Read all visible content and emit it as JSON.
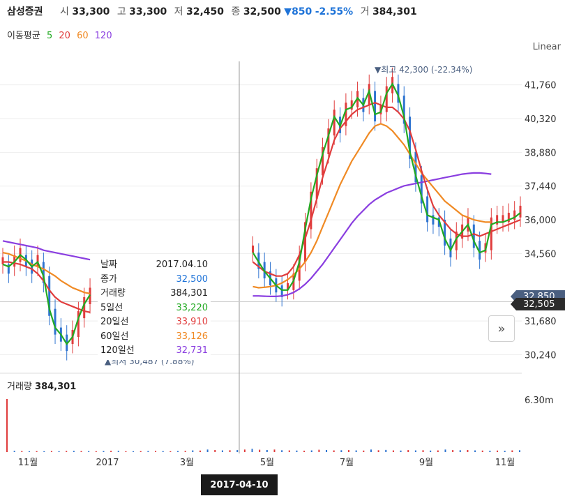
{
  "header": {
    "name": "삼성증권",
    "open_label": "시",
    "open": "33,300",
    "high_label": "고",
    "high": "33,300",
    "low_label": "저",
    "low": "32,450",
    "close_label": "종",
    "close": "32,500",
    "change": "▼850",
    "change_pct": "-2.55%",
    "volume_label": "거",
    "volume": "384,301"
  },
  "ma_legend": {
    "label": "이동평균",
    "ma5": "5",
    "ma20": "20",
    "ma60": "60",
    "ma120": "120"
  },
  "scale_label": "Linear",
  "tooltip": {
    "rows": [
      {
        "label": "날짜",
        "value": "2017.04.10"
      },
      {
        "label": "종가",
        "value": "32,500"
      },
      {
        "label": "거래량",
        "value": "384,301"
      },
      {
        "label": "5일선",
        "value": "33,220"
      },
      {
        "label": "20일선",
        "value": "33,910"
      },
      {
        "label": "60일선",
        "value": "33,126"
      },
      {
        "label": "120일선",
        "value": "32,731"
      }
    ]
  },
  "price_tags": {
    "blue": "32,850",
    "dark": "32,505"
  },
  "volume_title": {
    "label": "거래량",
    "value": "384,301"
  },
  "date_marker": "2017-04-10",
  "colors": {
    "up": "#e03c3c",
    "down": "#2f74d0",
    "ma5": "#22aa22",
    "ma20": "#e03c3c",
    "ma60": "#f08a24",
    "ma120": "#8a3ee0",
    "tooltip_close": "#1e73d8",
    "tooltip_volume": "#222222"
  },
  "chart_data": {
    "type": "line",
    "title": "삼성증권",
    "y_axis": {
      "ticks": [
        30240,
        31680,
        34560,
        36000,
        37440,
        38880,
        40320,
        41760
      ],
      "range": [
        29600,
        43000
      ]
    },
    "volume_axis": {
      "ticks": [
        "6.30m"
      ]
    },
    "x_axis": {
      "tick_labels": [
        "11월",
        "2017",
        "3월",
        "5월",
        "7월",
        "9월",
        "11월"
      ]
    },
    "annotations": [
      {
        "text": "▼최고 42,300 (-22.34%)",
        "value": 42300
      },
      {
        "text": "▲최저 30,487 (7.88%)",
        "value": 30487
      }
    ],
    "series": [
      {
        "name": "5",
        "color": "#22aa22",
        "values": [
          34100,
          34000,
          34200,
          34500,
          34300,
          34000,
          34200,
          33600,
          32200,
          31400,
          31100,
          30700,
          31000,
          31800,
          32400,
          32800,
          null,
          null,
          null,
          null,
          null,
          null,
          null,
          null,
          null,
          null,
          null,
          null,
          null,
          null,
          null,
          null,
          null,
          null,
          null,
          null,
          null,
          null,
          null,
          null,
          null,
          null,
          null,
          34600,
          34200,
          33800,
          33500,
          33200,
          33000,
          33000,
          33400,
          34200,
          35600,
          36900,
          37900,
          38800,
          39600,
          40400,
          40000,
          40700,
          40800,
          41200,
          40900,
          41500,
          40500,
          40600,
          41400,
          41800,
          41300,
          40400,
          38900,
          37900,
          37000,
          36200,
          36100,
          36000,
          35200,
          34700,
          35200,
          35500,
          35800,
          35100,
          34600,
          34700,
          35800,
          35900,
          35900,
          36000,
          36100,
          36300
        ]
      },
      {
        "name": "20",
        "color": "#e03c3c",
        "values": [
          34200,
          34200,
          34150,
          34100,
          34000,
          33900,
          33700,
          33400,
          33000,
          32700,
          32500,
          32400,
          32300,
          32200,
          32100,
          32050,
          null,
          null,
          null,
          null,
          null,
          null,
          null,
          null,
          null,
          null,
          null,
          null,
          null,
          null,
          null,
          null,
          null,
          null,
          null,
          null,
          null,
          null,
          null,
          null,
          null,
          null,
          null,
          34200,
          34000,
          33800,
          33700,
          33600,
          33600,
          33700,
          34000,
          34500,
          35200,
          36000,
          36900,
          37800,
          38600,
          39400,
          39900,
          40200,
          40500,
          40700,
          40800,
          40900,
          41000,
          40900,
          40800,
          40800,
          40600,
          40300,
          39800,
          39000,
          38100,
          37300,
          36600,
          36200,
          35900,
          35600,
          35400,
          35300,
          35300,
          35400,
          35300,
          35400,
          35500,
          35600,
          35700,
          35800,
          35900,
          36000
        ]
      },
      {
        "name": "60",
        "color": "#f08a24",
        "values": [
          34600,
          34550,
          34450,
          34350,
          34250,
          34100,
          34000,
          33900,
          33750,
          33600,
          33400,
          33250,
          33100,
          33000,
          32900,
          32850,
          null,
          null,
          null,
          null,
          null,
          null,
          null,
          null,
          null,
          null,
          null,
          null,
          null,
          null,
          null,
          null,
          null,
          null,
          null,
          null,
          null,
          null,
          null,
          null,
          null,
          null,
          null,
          33150,
          33100,
          33120,
          33150,
          33200,
          33300,
          33450,
          33650,
          33900,
          34200,
          34600,
          35100,
          35700,
          36300,
          36900,
          37500,
          38000,
          38500,
          38900,
          39300,
          39700,
          40000,
          40100,
          40000,
          39800,
          39500,
          39200,
          38800,
          38400,
          38000,
          37700,
          37400,
          37100,
          36800,
          36600,
          36400,
          36200,
          36100,
          36000,
          35950,
          35900,
          35900
        ]
      },
      {
        "name": "120",
        "color": "#8a3ee0",
        "values": [
          35100,
          35050,
          35000,
          34950,
          34900,
          34850,
          34800,
          34700,
          34650,
          34600,
          34550,
          34500,
          34450,
          34400,
          34350,
          34300,
          null,
          null,
          null,
          null,
          null,
          null,
          null,
          null,
          null,
          null,
          null,
          null,
          null,
          null,
          null,
          null,
          null,
          null,
          null,
          null,
          null,
          null,
          null,
          null,
          null,
          null,
          null,
          32750,
          32750,
          32740,
          32730,
          32730,
          32750,
          32800,
          32900,
          33050,
          33250,
          33500,
          33800,
          34100,
          34450,
          34800,
          35150,
          35500,
          35850,
          36150,
          36400,
          36650,
          36850,
          37000,
          37150,
          37250,
          37350,
          37450,
          37500,
          37550,
          37600,
          37650,
          37700,
          37750,
          37800,
          37850,
          37900,
          37950,
          37980,
          38000,
          38000,
          37980,
          37950
        ]
      }
    ],
    "volume": {
      "name": "거래량",
      "values": [
        6.3,
        0.15,
        0.12,
        0.1,
        0.11,
        0.1,
        0.12,
        0.1,
        0.13,
        0.14,
        0.12,
        0.11,
        0.1,
        0.12,
        0.15,
        0.14,
        0.1,
        0.1,
        0.11,
        0.12,
        0.13,
        0.11,
        0.1,
        0.12,
        0.14,
        0.2,
        0.18,
        0.3,
        0.25,
        0.2,
        0.22,
        0.24,
        0.3,
        0.38,
        0.28,
        0.25,
        0.3,
        0.22,
        0.2,
        0.18,
        0.16,
        0.2,
        0.28,
        0.25,
        0.2,
        0.22,
        0.24,
        0.2,
        0.18,
        0.3,
        0.22,
        0.26,
        0.2,
        0.18,
        0.24,
        0.2,
        0.22,
        0.18,
        0.2,
        0.3,
        0.24,
        0.22,
        0.25,
        0.2,
        0.18,
        0.16,
        0.18,
        0.15,
        0.2,
        0.22
      ]
    }
  }
}
